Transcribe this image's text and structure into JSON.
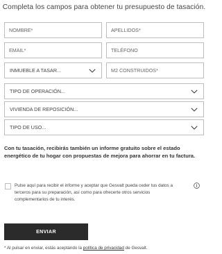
{
  "form": {
    "heading": "Completa los campos para obtener tu presupuesto de tasación.",
    "fields": {
      "nombre": {
        "placeholder": "NOMBRE*"
      },
      "apellidos": {
        "placeholder": "APELLIDOS*"
      },
      "email": {
        "placeholder": "EMAIL*"
      },
      "telefono": {
        "placeholder": "TELÉFONO"
      },
      "inmueble": {
        "value": "INMUEBLE A TASAR..."
      },
      "m2": {
        "placeholder": "M2 CONSTRUIDOS*"
      },
      "tipo_operacion": {
        "value": "TIPO DE OPERACIÓN..."
      },
      "vivienda_reposicion": {
        "value": "VIVIENDA DE REPOSICIÓN..."
      },
      "tipo_uso": {
        "value": "TIPO DE USO..."
      }
    },
    "info_text": "Con tu tasación, recibirás también un informe gratuito sobre el estado energético de tu hogar con propuestas de mejora para ahorrar en tu factura.",
    "consent": {
      "checked": false,
      "label": "Pulse aquí para recibir el informe y aceptar que Gesvalt pueda ceder tus datos a terceros para su preparación, así como para ofrecerte otros servicios complementarios de tu interés."
    },
    "submit_label": "ENVIAR",
    "legal": {
      "prefix": "* Al pulsar en enviar, estás aceptando la ",
      "link": "política de privacidad",
      "suffix": " de Gesvalt."
    }
  },
  "icons": {
    "select_arrow": "chevron-down-icon",
    "info": "info-circle-icon"
  },
  "colors": {
    "border": "#bdbdbd",
    "button_bg": "#2b2b2b",
    "button_text": "#ffffff",
    "text": "#333333"
  }
}
